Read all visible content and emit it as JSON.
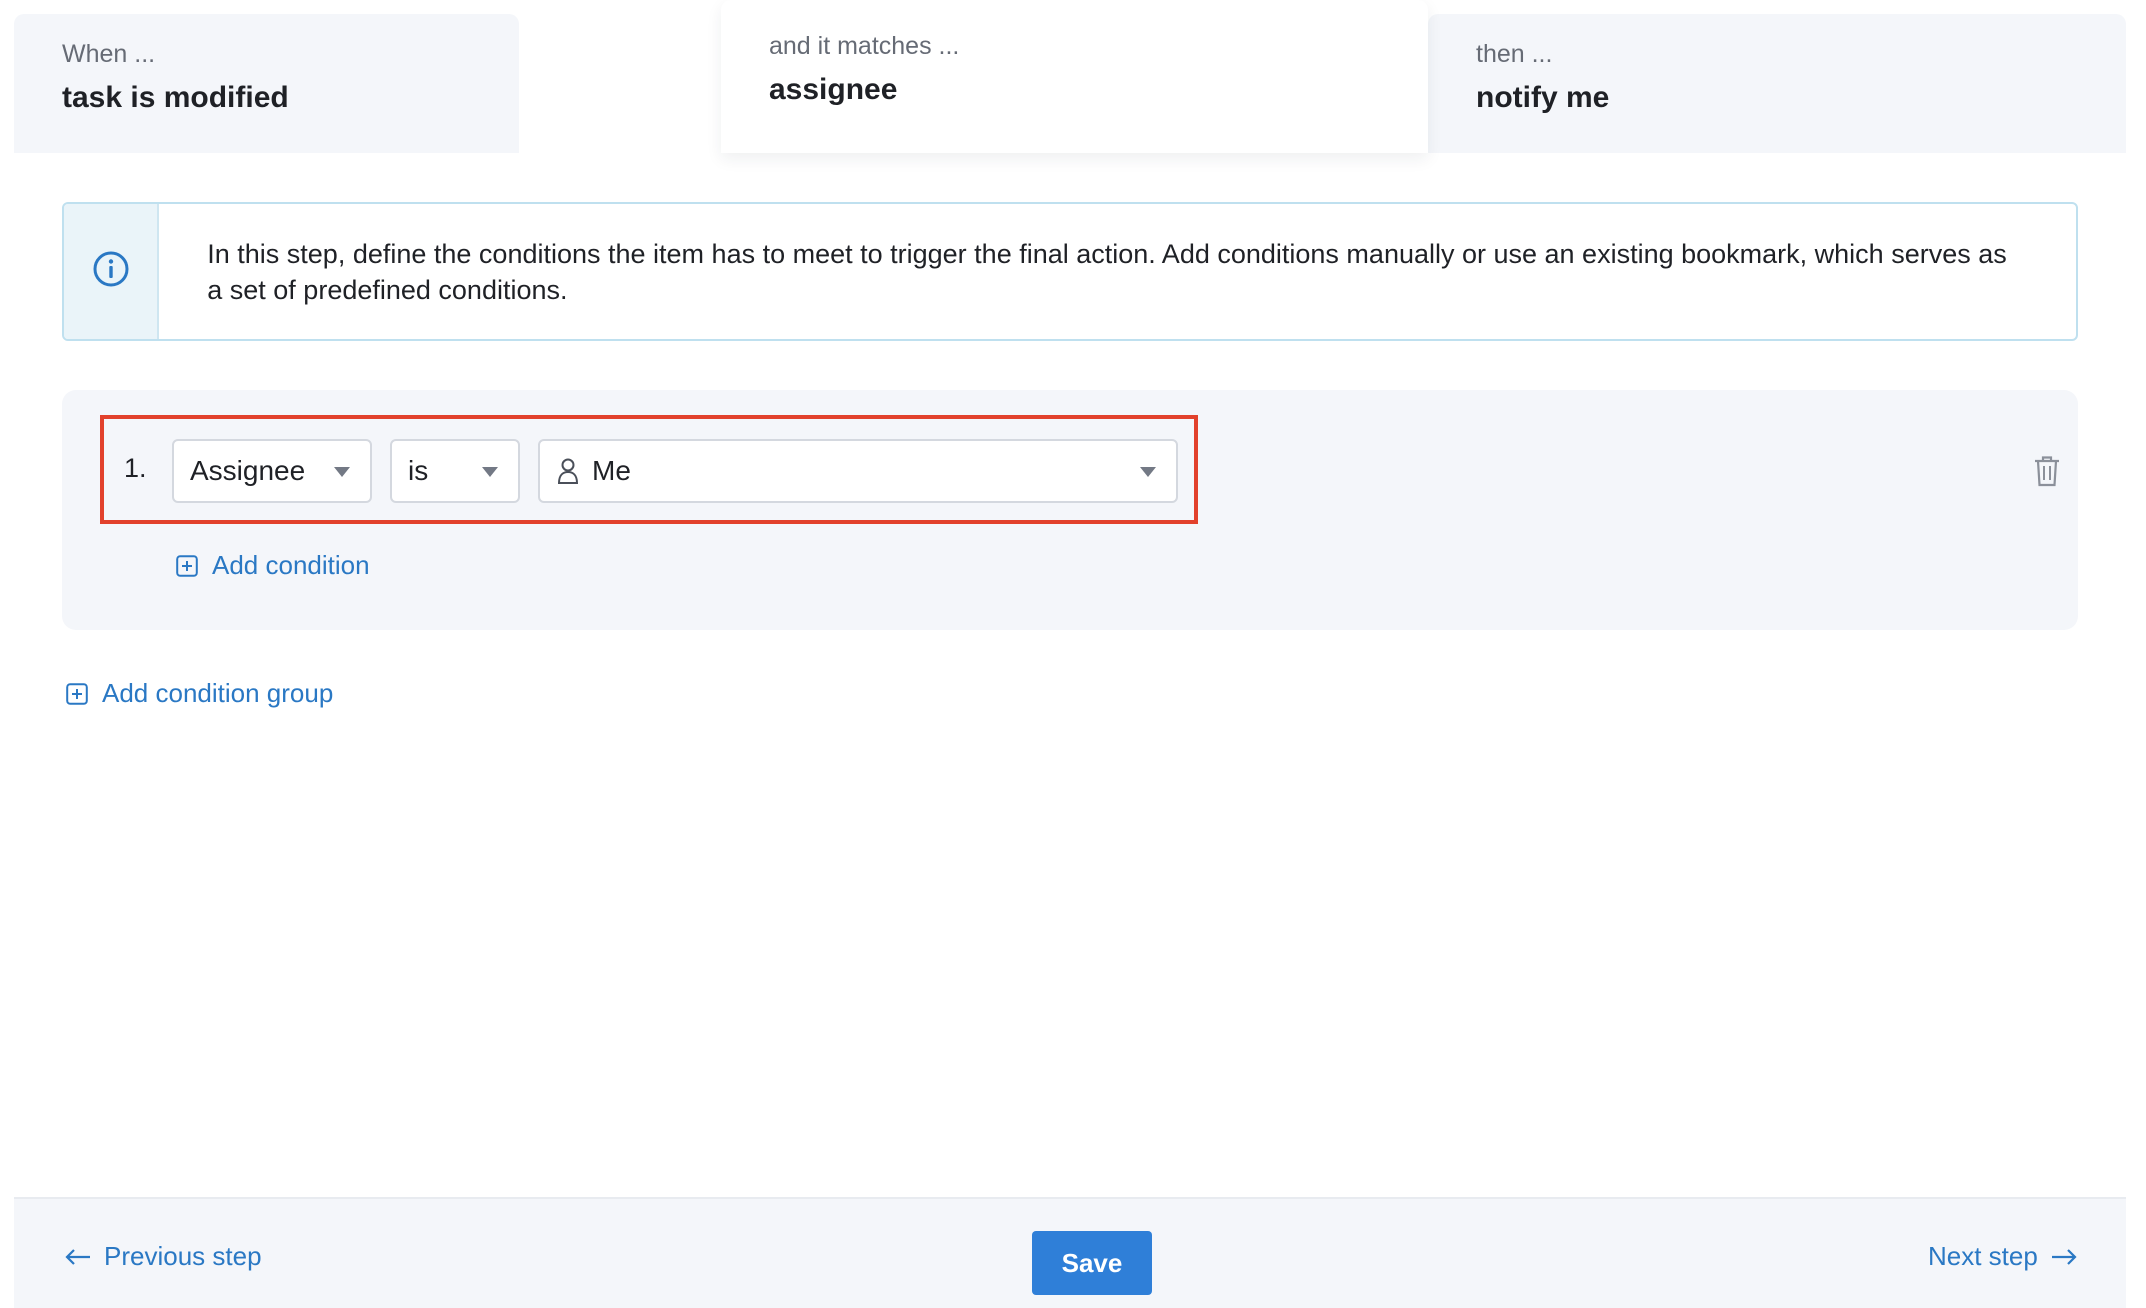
{
  "steps": [
    {
      "caption": "When ...",
      "value": "task is modified"
    },
    {
      "caption": "and it matches ...",
      "value": "assignee"
    },
    {
      "caption": "then ...",
      "value": "notify me"
    }
  ],
  "info": {
    "icon": "info-icon",
    "text": "In this step, define the conditions the item has to meet to trigger the final action. Add conditions manually or use an existing bookmark, which serves as a set of predefined conditions."
  },
  "condition_group": {
    "conditions": [
      {
        "number": "1.",
        "field": "Assignee",
        "operator": "is",
        "value": "Me",
        "value_icon": "person-icon"
      }
    ],
    "add_condition_label": "Add condition",
    "delete_icon": "trash-icon",
    "highlight_color": "#e2412c"
  },
  "add_group_label": "Add condition group",
  "footer": {
    "previous_label": "Previous step",
    "save_label": "Save",
    "next_label": "Next step"
  },
  "colors": {
    "accent": "#2f7fd8",
    "link": "#2a78c4",
    "panel": "#f4f6fa"
  }
}
